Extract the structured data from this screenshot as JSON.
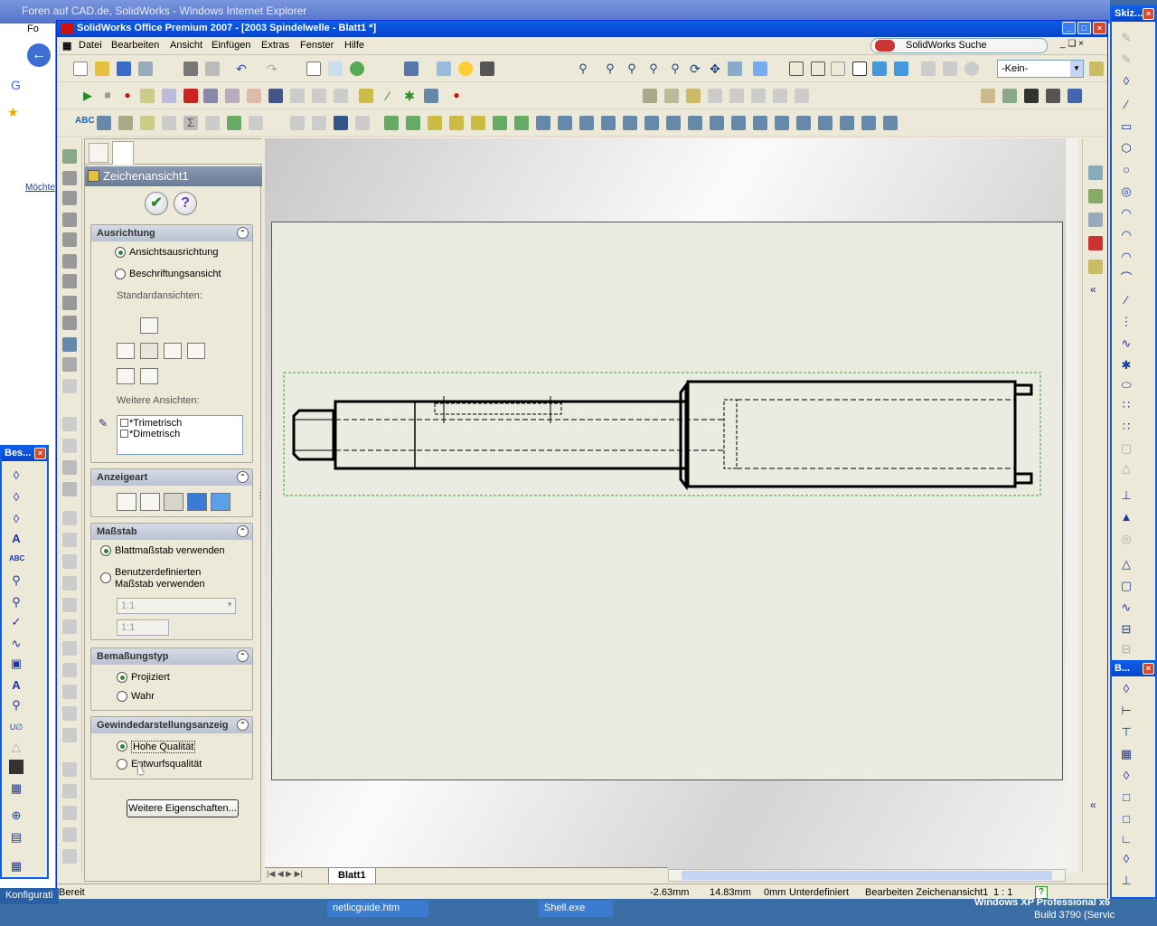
{
  "ie": {
    "title": "Foren auf CAD.de, SolidWorks - Windows Internet Explorer",
    "tab_fragment": "Fo",
    "sidebar_text": "Möchte"
  },
  "sw": {
    "title": "SolidWorks Office Premium 2007 - [2003 Spindelwelle - Blatt1 *]",
    "menu": [
      "Datei",
      "Bearbeiten",
      "Ansicht",
      "Einfügen",
      "Extras",
      "Fenster",
      "Hilfe"
    ],
    "search_label": "SolidWorks Suche",
    "layer_select": "-Kein-"
  },
  "pm": {
    "title": "Zeichenansicht1",
    "ausrichtung": {
      "header": "Ausrichtung",
      "opt1": "Ansichtsausrichtung",
      "opt2": "Beschriftungsansicht",
      "std_label": "Standardansichten:",
      "more_label": "Weitere Ansichten:",
      "list": [
        "*Trimetrisch",
        "*Dimetrisch"
      ]
    },
    "anzeigeart": {
      "header": "Anzeigeart"
    },
    "massstab": {
      "header": "Maßstab",
      "opt1": "Blattmaßstab verwenden",
      "opt2_line1": "Benutzerdefinierten",
      "opt2_line2": "Maßstab verwenden",
      "select_value": "1:1",
      "input_value": "1:1"
    },
    "bemassung": {
      "header": "Bemaßungstyp",
      "opt1": "Projiziert",
      "opt2": "Wahr"
    },
    "gewinde": {
      "header": "Gewindedarstellungsanzeig",
      "opt1": "Hohe Qualität",
      "opt2": "Entwurfsqualität"
    },
    "more_button": "Weitere Eigenschaften..."
  },
  "sheet_tab": "Blatt1",
  "status": {
    "ready": "Bereit",
    "x": "-2.63mm",
    "y": "14.83mm",
    "z": "0mm",
    "state": "Unterdefiniert",
    "editing": "Bearbeiten Zeichenansicht1",
    "scale": "1 : 1"
  },
  "floating": {
    "left_title": "Bes...",
    "right_top_title": "Skiz...",
    "right_bottom_title": "B..."
  },
  "taskbar": {
    "left_fragment": "Konfigurati",
    "task1": "netlicguide.htm",
    "task2": "Shell.exe",
    "os_line": "Windows XP Professional x6",
    "build_line": "Build 3790 (Servic"
  },
  "colors": {
    "titlebar": "#0a5ee8",
    "sheet": "#ecebe2",
    "bounding_box": "#2fa82f",
    "radio_selected": "#2b8a2b"
  }
}
